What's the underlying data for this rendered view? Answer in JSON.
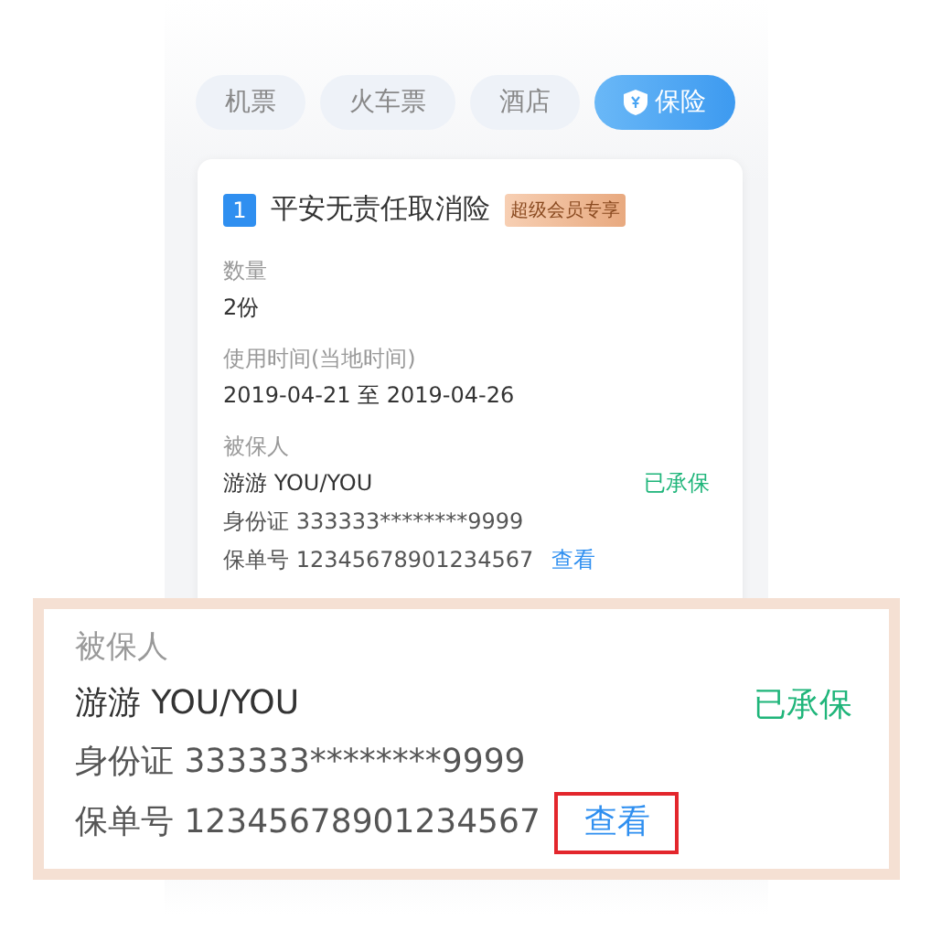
{
  "tabs": [
    {
      "label": "机票",
      "selected": false
    },
    {
      "label": "火车票",
      "selected": false
    },
    {
      "label": "酒店",
      "selected": false
    },
    {
      "label": "保险",
      "selected": true
    }
  ],
  "card": {
    "index": "1",
    "title": "平安无责任取消险",
    "badge": "超级会员专享",
    "fields": [
      {
        "label": "数量",
        "value": "2份"
      },
      {
        "label": "使用时间(当地时间)",
        "value": "2019-04-21 至 2019-04-26"
      }
    ],
    "insured": {
      "label": "被保人",
      "name": "游游 YOU/YOU",
      "status": "已承保",
      "id": "身份证 333333********9999",
      "policy": "保单号 12345678901234567",
      "view": "查看"
    }
  },
  "callout": {
    "label": "被保人",
    "name": "游游 YOU/YOU",
    "status": "已承保",
    "id": "身份证 333333********9999",
    "policy": "保单号 12345678901234567",
    "view": "查看",
    "view_highlighted": true
  }
}
